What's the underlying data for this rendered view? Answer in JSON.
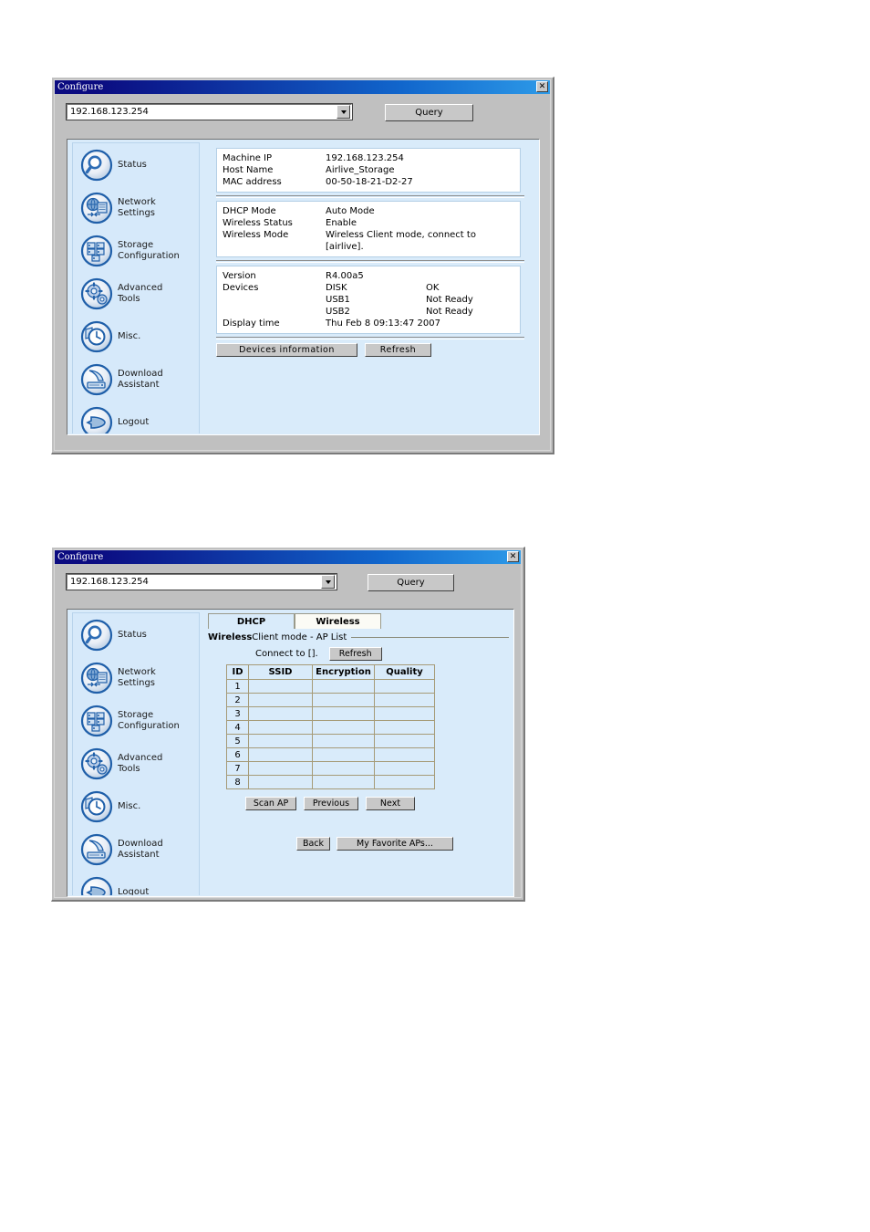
{
  "window1": {
    "title": "Configure",
    "close_label": "✕",
    "address_value": "192.168.123.254",
    "address_placeholder": "192.168.123.254",
    "query_label": "Query",
    "sidebar": {
      "items": [
        {
          "label": "Status",
          "icon": "magnifier-icon"
        },
        {
          "label": "Network\nSettings",
          "icon": "network-icon"
        },
        {
          "label": "Storage\nConfiguration",
          "icon": "storage-grid-icon"
        },
        {
          "label": "Advanced\nTools",
          "icon": "gears-icon"
        },
        {
          "label": "Misc.",
          "icon": "clock-icon"
        },
        {
          "label": "Download\nAssistant",
          "icon": "download-icon"
        },
        {
          "label": "Logout",
          "icon": "logout-arrow-icon"
        }
      ]
    },
    "info": {
      "group1": [
        {
          "key": "Machine IP",
          "value": "192.168.123.254"
        },
        {
          "key": "Host Name",
          "value": "Airlive_Storage"
        },
        {
          "key": "MAC address",
          "value": "00-50-18-21-D2-27"
        }
      ],
      "group2": [
        {
          "key": "DHCP Mode",
          "value": "Auto Mode"
        },
        {
          "key": "Wireless Status",
          "value": "Enable"
        },
        {
          "key": "Wireless Mode",
          "value": "Wireless Client mode, connect to [airlive]."
        }
      ],
      "group3": {
        "version_key": "Version",
        "version_value": "R4.00a5",
        "devices_key": "Devices",
        "devices": [
          {
            "name": "DISK",
            "status": "OK"
          },
          {
            "name": "USB1",
            "status": "Not Ready"
          },
          {
            "name": "USB2",
            "status": "Not Ready"
          }
        ],
        "display_time_key": "Display time",
        "display_time_value": "Thu Feb 8 09:13:47 2007"
      }
    },
    "buttons": {
      "devices_information": "Devices information",
      "refresh": "Refresh"
    }
  },
  "window2": {
    "title": "Configure",
    "close_label": "✕",
    "address_value": "192.168.123.254",
    "address_placeholder": "192.168.123.254",
    "query_label": "Query",
    "sidebar": {
      "items": [
        {
          "label": "Status",
          "icon": "magnifier-icon"
        },
        {
          "label": "Network\nSettings",
          "icon": "network-icon"
        },
        {
          "label": "Storage\nConfiguration",
          "icon": "storage-grid-icon"
        },
        {
          "label": "Advanced\nTools",
          "icon": "gears-icon"
        },
        {
          "label": "Misc.",
          "icon": "clock-icon"
        },
        {
          "label": "Download\nAssistant",
          "icon": "download-icon"
        },
        {
          "label": "Logout",
          "icon": "logout-arrow-icon"
        }
      ]
    },
    "tabs": [
      {
        "label": "DHCP",
        "active": false
      },
      {
        "label": "Wireless",
        "active": true
      }
    ],
    "section_title_bold": "Wireless",
    "section_title_rest": " Client mode - AP List",
    "connect_to_label": "Connect to [].",
    "refresh_label": "Refresh",
    "table": {
      "columns": [
        "ID",
        "SSID",
        "Encryption",
        "Quality"
      ],
      "rows": [
        {
          "id": "1",
          "ssid": "",
          "encryption": "",
          "quality": ""
        },
        {
          "id": "2",
          "ssid": "",
          "encryption": "",
          "quality": ""
        },
        {
          "id": "3",
          "ssid": "",
          "encryption": "",
          "quality": ""
        },
        {
          "id": "4",
          "ssid": "",
          "encryption": "",
          "quality": ""
        },
        {
          "id": "5",
          "ssid": "",
          "encryption": "",
          "quality": ""
        },
        {
          "id": "6",
          "ssid": "",
          "encryption": "",
          "quality": ""
        },
        {
          "id": "7",
          "ssid": "",
          "encryption": "",
          "quality": ""
        },
        {
          "id": "8",
          "ssid": "",
          "encryption": "",
          "quality": ""
        }
      ]
    },
    "buttons": {
      "scan_ap": "Scan AP",
      "previous": "Previous",
      "next": "Next",
      "back": "Back",
      "my_favorite_aps": "My Favorite APs..."
    }
  },
  "colors": {
    "titlebar_start": "#0b0b80",
    "titlebar_end": "#2d9ae8",
    "window_face": "#c0c0c0",
    "pane_background": "#d9ebfa",
    "sidebar_background": "#d6e9fa",
    "icon_blue": "#1f5fa9",
    "table_border": "#a69b78",
    "tab_active": "#fbfbf5"
  }
}
